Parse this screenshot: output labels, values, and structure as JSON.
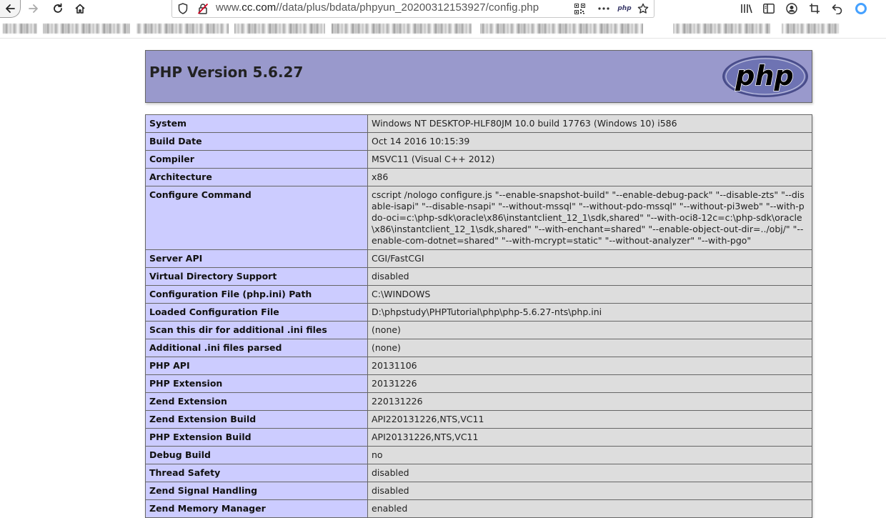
{
  "browser": {
    "url_prefix": "www.",
    "url_host": "cc.com",
    "url_path": "//data/plus/bdata/phpyun_20200312153927/config.php",
    "php_badge": "php"
  },
  "colors": {
    "header_bg": "#9999cc",
    "label_bg": "#ccccff",
    "value_bg": "#dddddd",
    "border": "#666666"
  },
  "phpinfo": {
    "title": "PHP Version 5.6.27",
    "logo_text": "php",
    "rows": [
      {
        "label": "System",
        "value": "Windows NT DESKTOP-HLF80JM 10.0 build 17763 (Windows 10) i586"
      },
      {
        "label": "Build Date",
        "value": "Oct 14 2016 10:15:39"
      },
      {
        "label": "Compiler",
        "value": "MSVC11 (Visual C++ 2012)"
      },
      {
        "label": "Architecture",
        "value": "x86"
      },
      {
        "label": "Configure Command",
        "value": "cscript /nologo configure.js \"--enable-snapshot-build\" \"--enable-debug-pack\" \"--disable-zts\" \"--disable-isapi\" \"--disable-nsapi\" \"--without-mssql\" \"--without-pdo-mssql\" \"--without-pi3web\" \"--with-pdo-oci=c:\\php-sdk\\oracle\\x86\\instantclient_12_1\\sdk,shared\" \"--with-oci8-12c=c:\\php-sdk\\oracle\\x86\\instantclient_12_1\\sdk,shared\" \"--with-enchant=shared\" \"--enable-object-out-dir=../obj/\" \"--enable-com-dotnet=shared\" \"--with-mcrypt=static\" \"--without-analyzer\" \"--with-pgo\""
      },
      {
        "label": "Server API",
        "value": "CGI/FastCGI"
      },
      {
        "label": "Virtual Directory Support",
        "value": "disabled"
      },
      {
        "label": "Configuration File (php.ini) Path",
        "value": "C:\\WINDOWS"
      },
      {
        "label": "Loaded Configuration File",
        "value": "D:\\phpstudy\\PHPTutorial\\php\\php-5.6.27-nts\\php.ini"
      },
      {
        "label": "Scan this dir for additional .ini files",
        "value": "(none)"
      },
      {
        "label": "Additional .ini files parsed",
        "value": "(none)"
      },
      {
        "label": "PHP API",
        "value": "20131106"
      },
      {
        "label": "PHP Extension",
        "value": "20131226"
      },
      {
        "label": "Zend Extension",
        "value": "220131226"
      },
      {
        "label": "Zend Extension Build",
        "value": "API220131226,NTS,VC11"
      },
      {
        "label": "PHP Extension Build",
        "value": "API20131226,NTS,VC11"
      },
      {
        "label": "Debug Build",
        "value": "no"
      },
      {
        "label": "Thread Safety",
        "value": "disabled"
      },
      {
        "label": "Zend Signal Handling",
        "value": "disabled"
      },
      {
        "label": "Zend Memory Manager",
        "value": "enabled"
      }
    ]
  }
}
